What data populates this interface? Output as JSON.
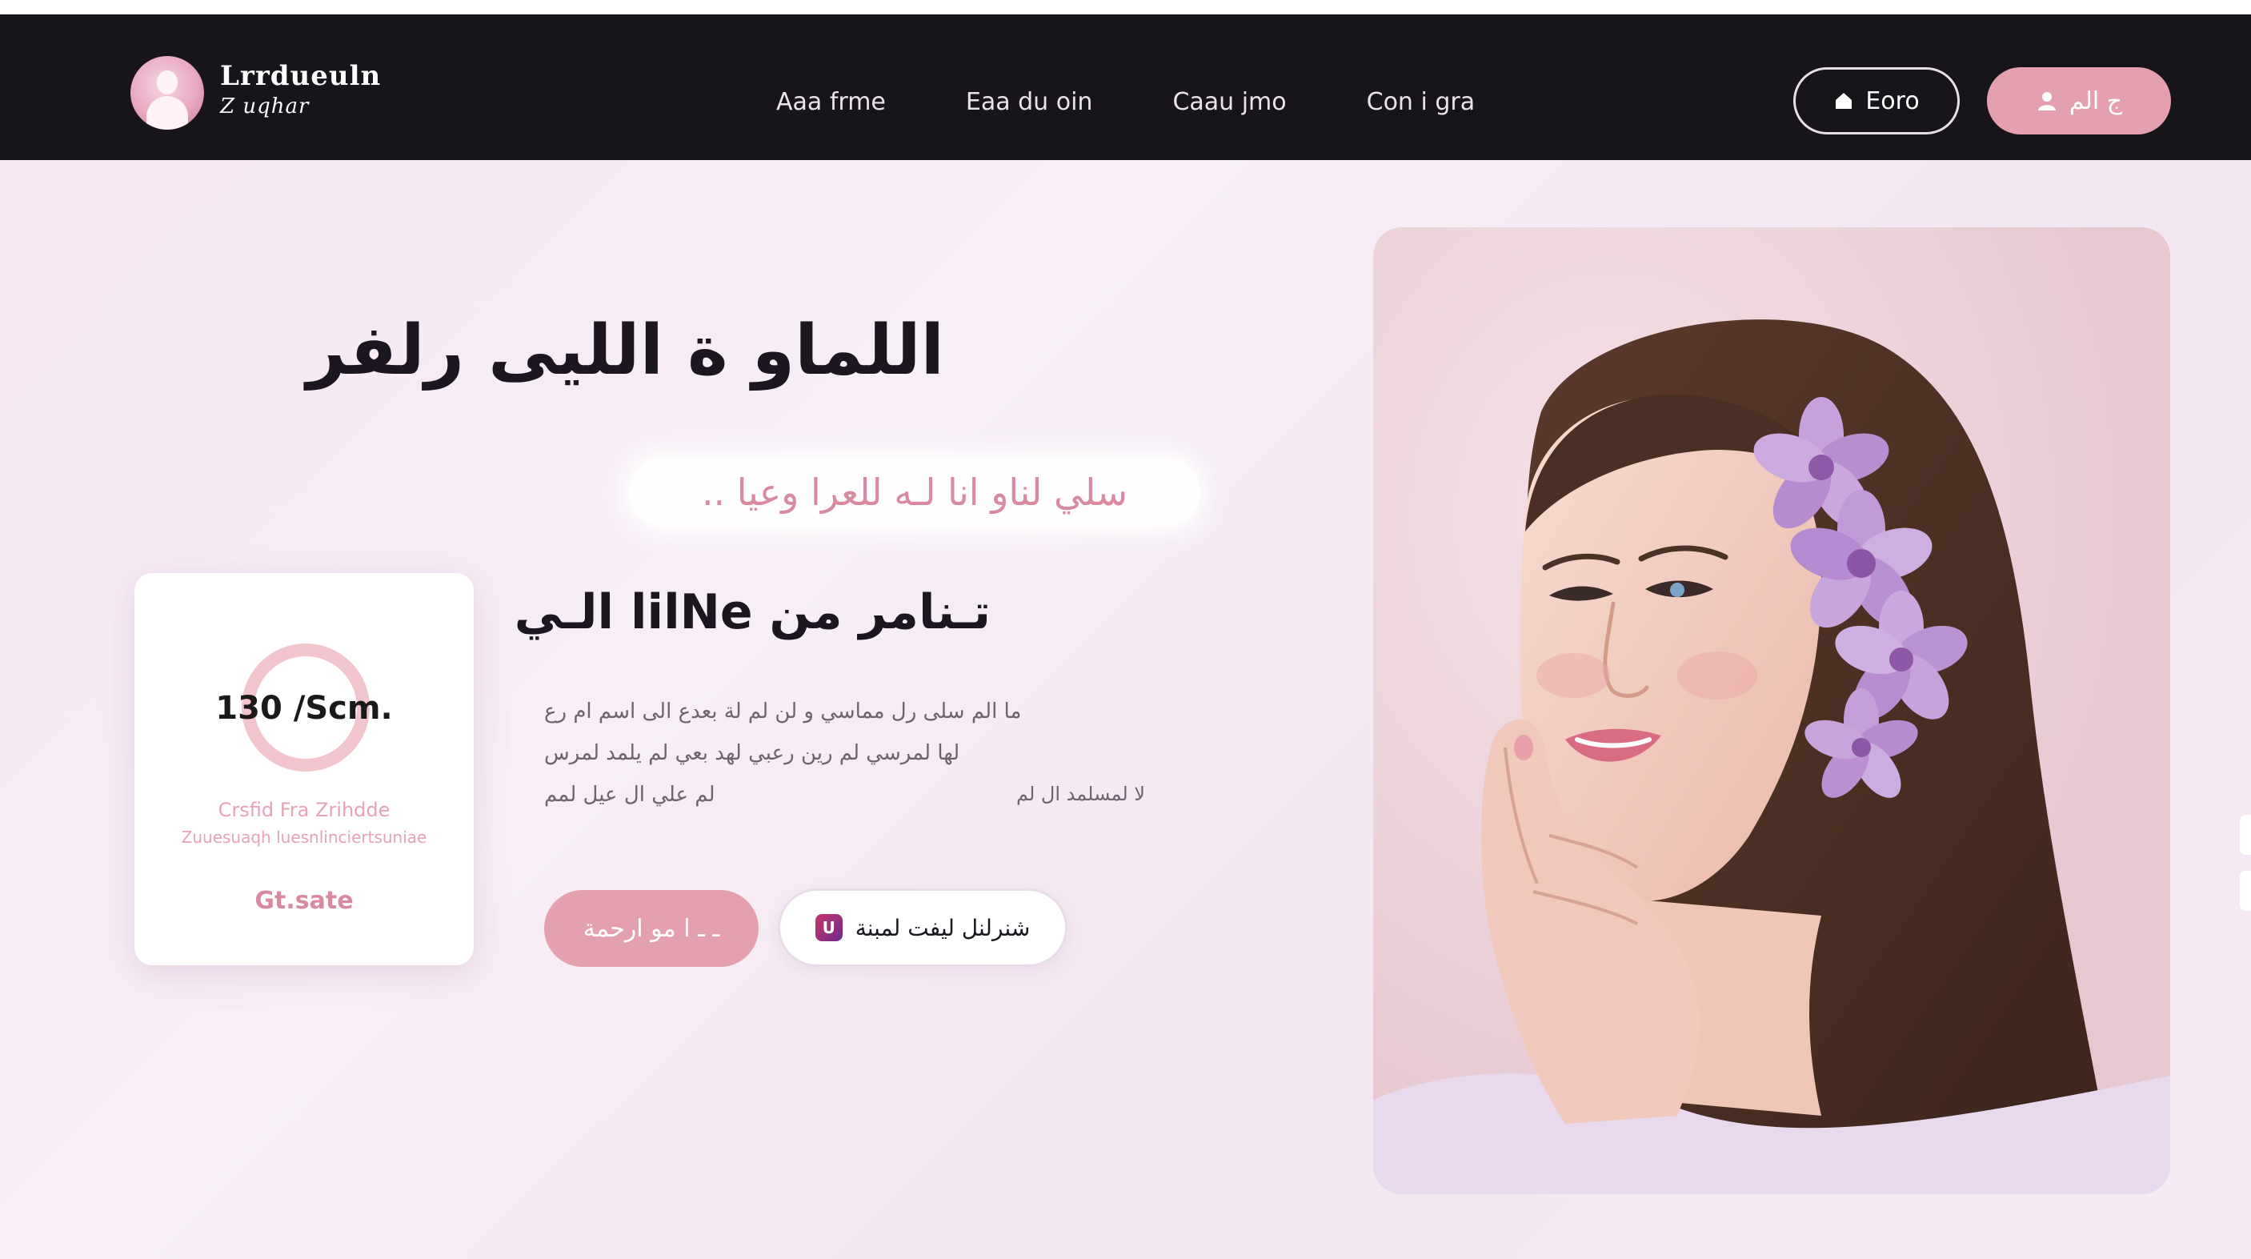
{
  "nav": {
    "brand_line1": "Lrrdueuln",
    "brand_line2": "Z uqhar",
    "links": [
      "Aaa frme",
      "Eaa du oin",
      "Caau jmo",
      "Con i gra"
    ],
    "login_label": "Eoro",
    "cta_label": "ج الم"
  },
  "hero": {
    "title": "اللماو ة الليى رلفر",
    "subtitle": "سلي لناو انا لـه للعرا وعيا ..",
    "stat": {
      "value": "130 /Scm.",
      "caption_line1": "Crsfid Fra Zrihdde",
      "caption_line2": "Zuuesuaqh luesnlinciertsuniae",
      "link": "Gt.sate"
    },
    "content_heading": "تـنامر من lilNe الـي",
    "paragraph": [
      "ما الم سلى رل مماسي و لن لم لة بعدع الى اسم ام رع",
      "لها لمرسي لم رين رعبي لهد بعي لم يلمد لمرس",
      "لم علي ال عيل لمم"
    ],
    "paragraph_side": "لا لمسلمد ال لم",
    "primary_button": "ـ ـ ا مو ارحمة",
    "secondary_button": "شنرلنل ليفت لمبنة"
  },
  "colors": {
    "nav_bg": "#17141a",
    "accent_pink": "#e4a0ae",
    "hero_bg": "#f6e8f3"
  }
}
